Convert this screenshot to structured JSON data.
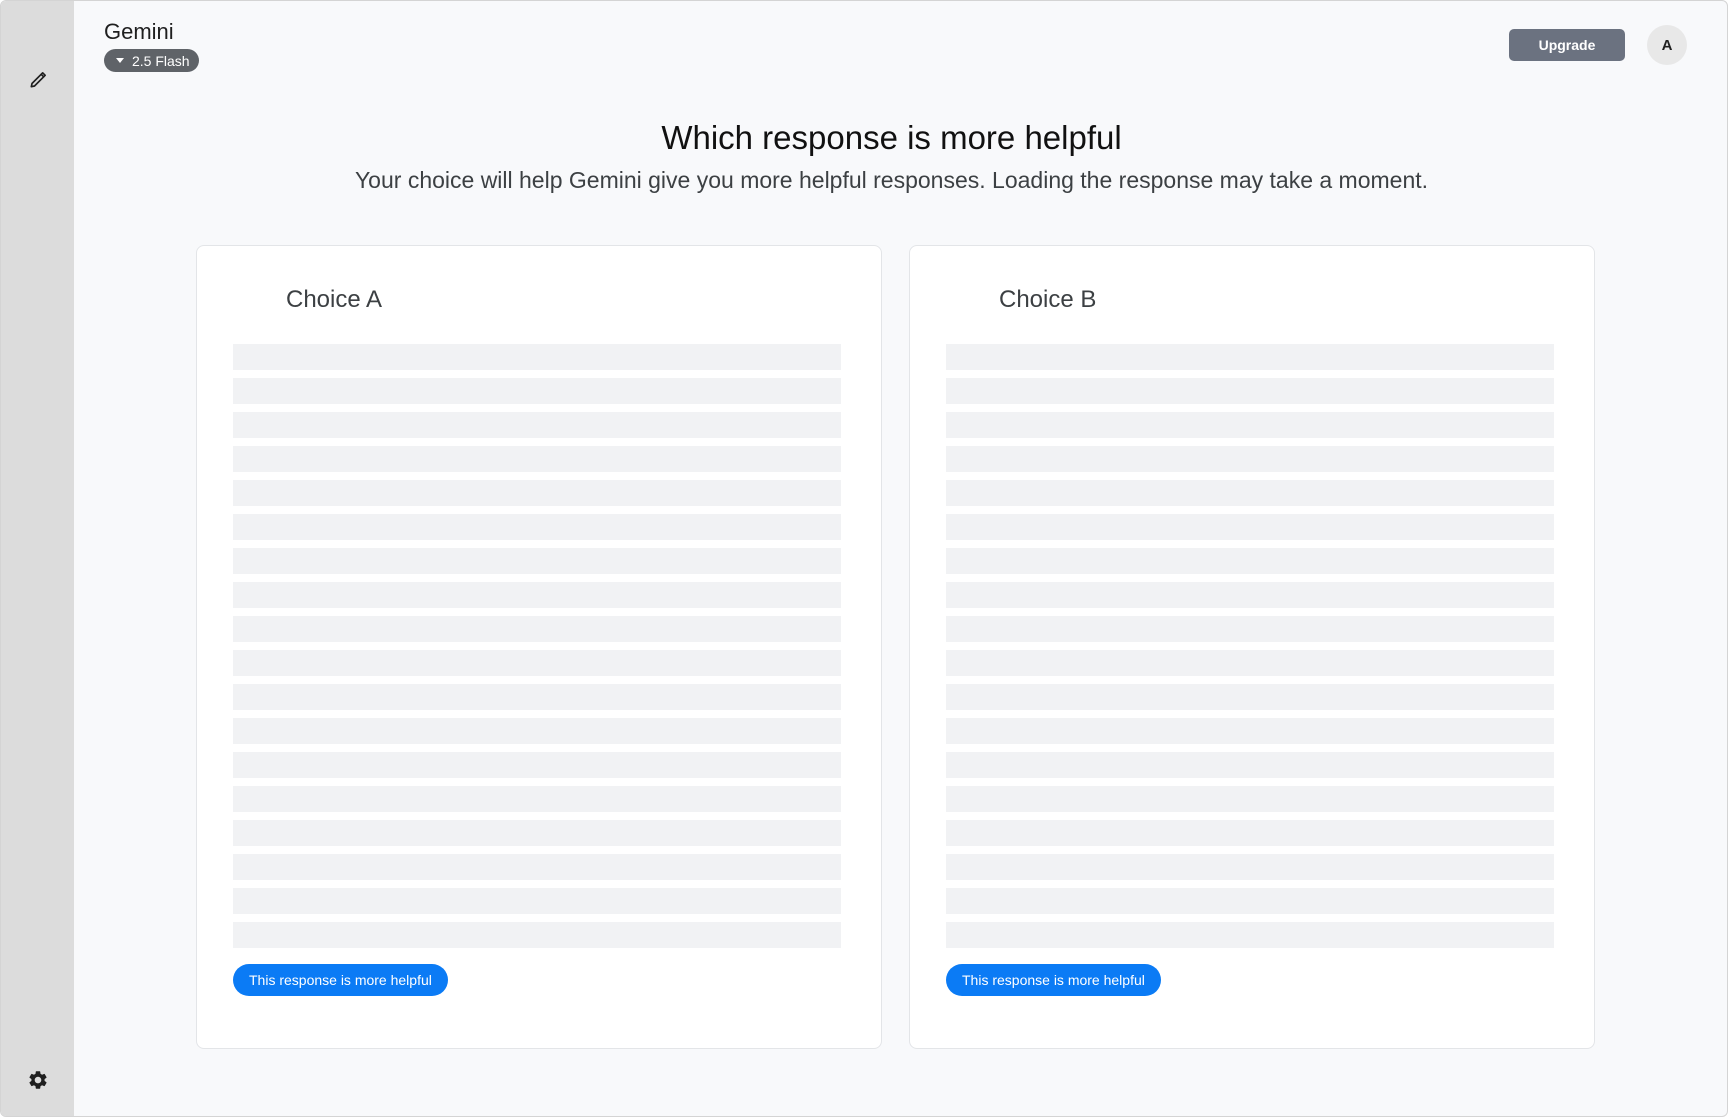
{
  "app": {
    "name": "Gemini",
    "model": "2.5 Flash"
  },
  "header": {
    "upgrade_label": "Upgrade",
    "avatar_initial": "A"
  },
  "comparison": {
    "title": "Which response is more helpful",
    "subtitle": "Your choice will help Gemini give you more helpful responses. Loading the response may take a moment.",
    "choices": [
      {
        "label": "Choice A",
        "button_label": "This response is more helpful",
        "loading": true
      },
      {
        "label": "Choice B",
        "button_label": "This response is more helpful",
        "loading": true
      }
    ]
  },
  "sidebar": {
    "icons": [
      "edit-icon",
      "settings-icon"
    ]
  },
  "colors": {
    "accent": "#0b7bf5",
    "upgrade_button": "#6b7280",
    "model_pill": "#5f6368",
    "skeleton": "#f1f2f4",
    "sidebar": "#dcdcdc"
  }
}
